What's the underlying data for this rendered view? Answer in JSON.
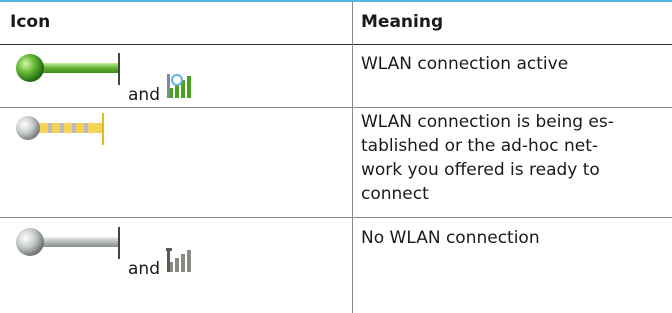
{
  "table": {
    "headers": {
      "icon": "Icon",
      "meaning": "Meaning"
    },
    "rows": [
      {
        "icon_names": [
          "wlan-active-indicator-icon",
          "wlan-signal-green-icon"
        ],
        "connector": "and",
        "meaning": "WLAN connection active"
      },
      {
        "icon_names": [
          "wlan-establishing-indicator-icon"
        ],
        "connector": "",
        "meaning_lines": [
          "WLAN connection is being es-",
          "tablished or the ad-hoc net-",
          "work you offered is ready to",
          "connect"
        ]
      },
      {
        "icon_names": [
          "wlan-inactive-indicator-icon",
          "wlan-signal-gray-icon"
        ],
        "connector": "and",
        "meaning": "No WLAN connection"
      }
    ]
  },
  "colors": {
    "accent_line": "#55b3e3",
    "active_green": "#5fb030",
    "establishing_yellow": "#f0c020",
    "inactive_gray": "#b8bcbc"
  }
}
